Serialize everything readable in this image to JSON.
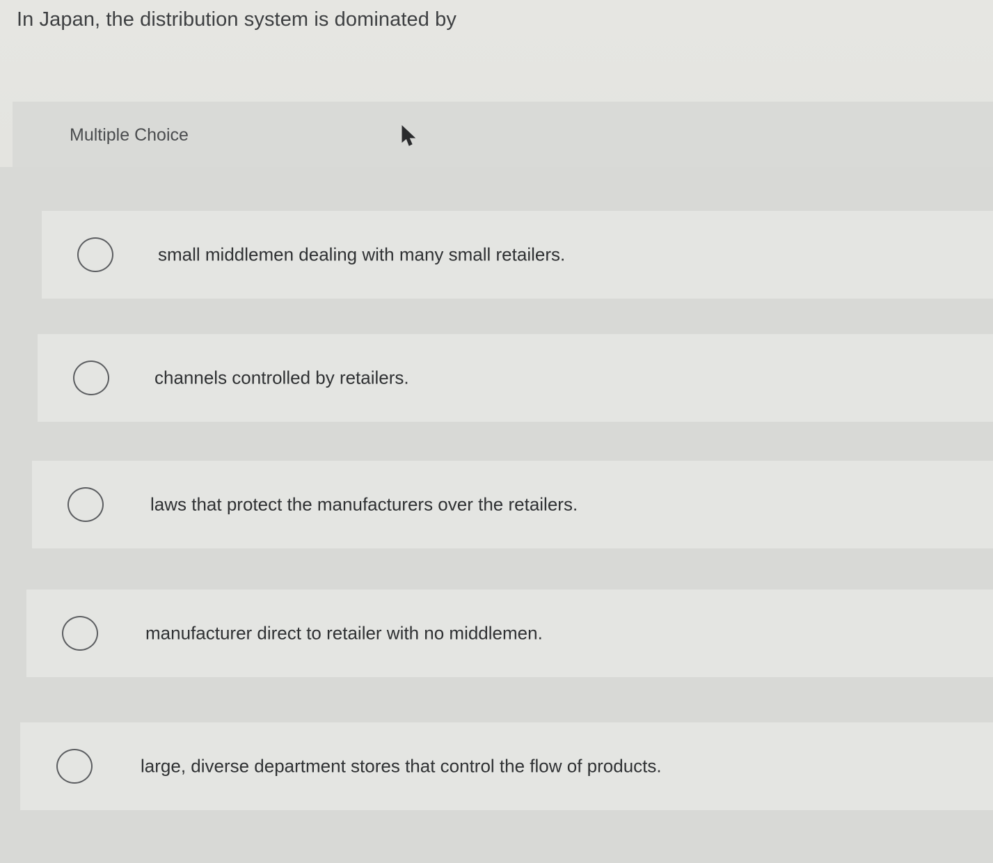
{
  "question": {
    "text": "In Japan, the distribution system is dominated by"
  },
  "header": {
    "label": "Multiple Choice"
  },
  "options": [
    {
      "label": "small middlemen dealing with many small retailers."
    },
    {
      "label": "channels controlled by retailers."
    },
    {
      "label": "laws that protect the manufacturers over the retailers."
    },
    {
      "label": "manufacturer direct to retailer with no middlemen."
    },
    {
      "label": "large, diverse department stores that control the flow of products."
    }
  ],
  "icons": {
    "radio": "radio-button-icon",
    "cursor": "mouse-pointer-icon"
  }
}
